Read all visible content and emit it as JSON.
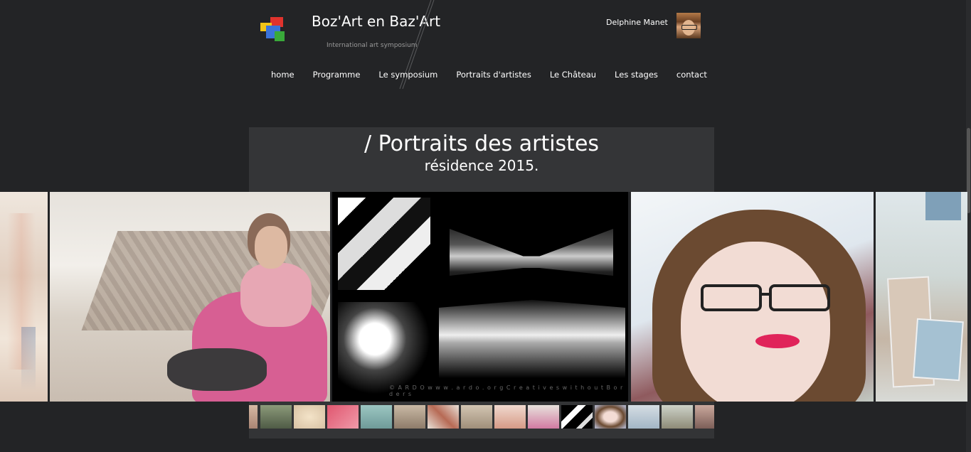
{
  "header": {
    "site_title": "Boz'Art en Baz'Art",
    "tagline": "International art symposium",
    "user_name": "Delphine Manet"
  },
  "nav": {
    "items": [
      {
        "label": "home"
      },
      {
        "label": "Programme"
      },
      {
        "label": "Le symposium"
      },
      {
        "label": "Portraits d'artistes"
      },
      {
        "label": "Le Château"
      },
      {
        "label": "Les stages"
      },
      {
        "label": "contact"
      }
    ]
  },
  "page": {
    "title": "/ Portraits des artistes",
    "subtitle": "résidence 2015."
  },
  "gallery": {
    "caption": "© A R D O   w w w . a r d o . o r g   C r e a t i v e s   w i t h o u t   B o r d e r s"
  },
  "colors": {
    "background": "#232426",
    "panel": "#343537",
    "logo_red": "#e0332d",
    "logo_blue": "#3b73d9",
    "logo_yellow": "#f2c417",
    "logo_green": "#39a93a"
  }
}
